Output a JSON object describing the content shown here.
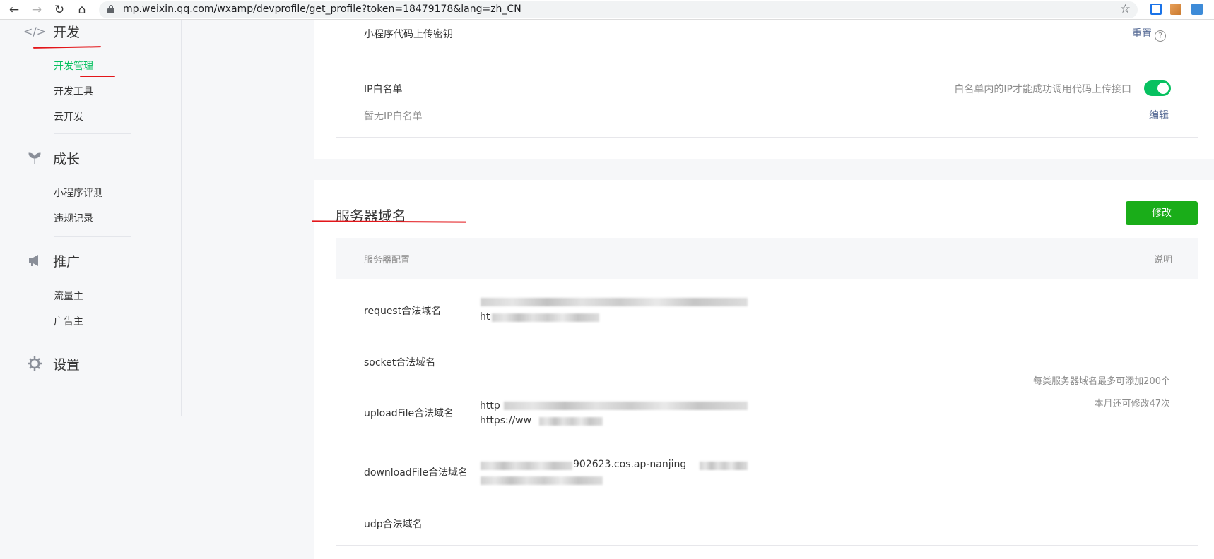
{
  "browser": {
    "url": "mp.weixin.qq.com/wxamp/devprofile/get_profile?token=18479178&lang=zh_CN"
  },
  "sidebar": {
    "groups": [
      {
        "title": "开发",
        "icon": "code-icon",
        "items": [
          "开发管理",
          "开发工具",
          "云开发"
        ],
        "active": "开发管理"
      },
      {
        "title": "成长",
        "icon": "sprout-icon",
        "items": [
          "小程序评测",
          "违规记录"
        ]
      },
      {
        "title": "推广",
        "icon": "megaphone-icon",
        "items": [
          "流量主",
          "广告主"
        ]
      },
      {
        "title": "设置",
        "icon": "gear-icon",
        "items": []
      }
    ]
  },
  "upload_key": {
    "label": "小程序代码上传密钥",
    "reset_label": "重置",
    "help_glyph": "?"
  },
  "ip_whitelist": {
    "label": "IP白名单",
    "empty_text": "暂无IP白名单",
    "toggle_desc": "白名单内的IP才能成功调用代码上传接口",
    "toggle_on": true,
    "edit_label": "编辑"
  },
  "server_domain": {
    "title": "服务器域名",
    "modify_label": "修改",
    "header_config": "服务器配置",
    "header_desc": "说明",
    "rows": [
      {
        "label": "request合法域名",
        "visible_text": [
          "ht"
        ]
      },
      {
        "label": "socket合法域名",
        "visible_text": []
      },
      {
        "label": "uploadFile合法域名",
        "visible_text": [
          "http",
          "https://ww"
        ]
      },
      {
        "label": "downloadFile合法域名",
        "visible_text": [
          "902623.cos.ap-nanjing"
        ]
      },
      {
        "label": "udp合法域名",
        "visible_text": []
      }
    ],
    "hint_max": "每类服务器域名最多可添加200个",
    "hint_remaining": "本月还可修改47次"
  },
  "colors": {
    "accent_green": "#07c160",
    "button_green": "#1aad19",
    "link_blue": "#576b95",
    "annotation_red": "#e3161a"
  }
}
